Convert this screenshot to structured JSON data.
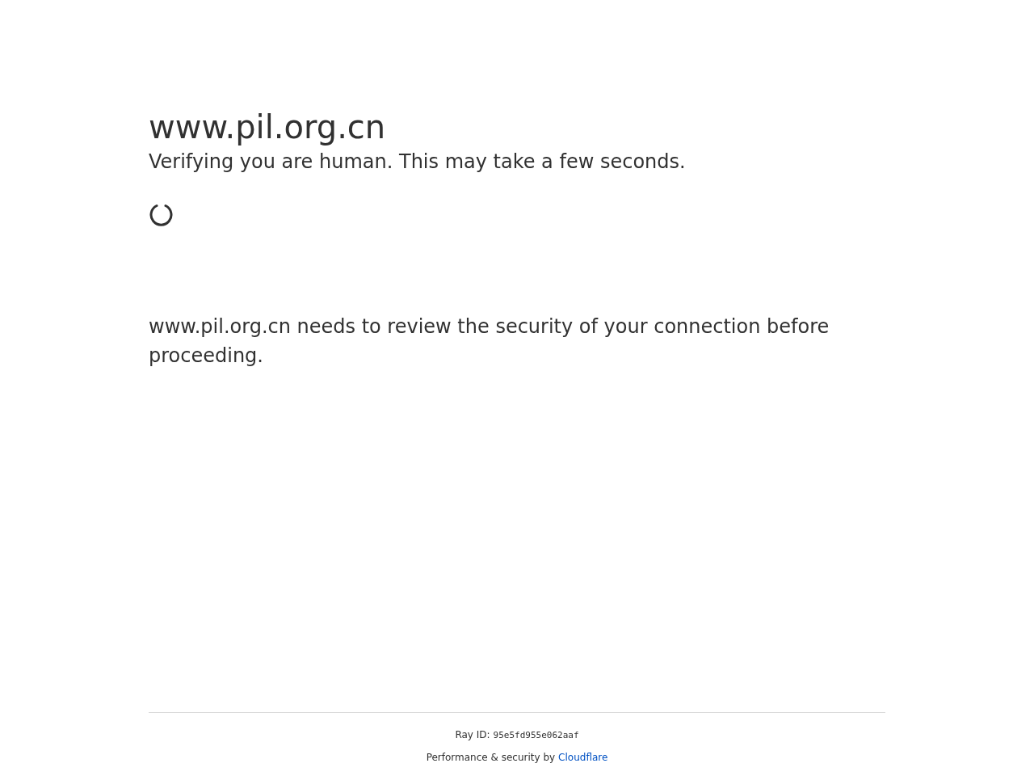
{
  "heading": "www.pil.org.cn",
  "subheading": "Verifying you are human. This may take a few seconds.",
  "message": "www.pil.org.cn needs to review the security of your connection before proceeding.",
  "footer": {
    "ray_label": "Ray ID:",
    "ray_id": "95e5fd955e062aaf",
    "credit": "Performance & security by",
    "link": "Cloudflare"
  }
}
